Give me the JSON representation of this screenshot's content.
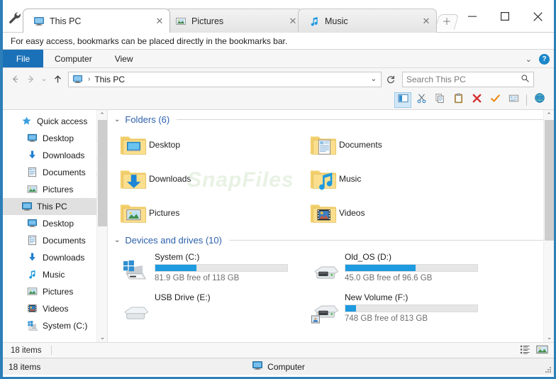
{
  "window": {
    "minimize_label": "─",
    "maximize_label": "☐",
    "close_label": "✕",
    "tools_icon": "wrench-icon"
  },
  "tabs": [
    {
      "label": "This PC",
      "icon": "this-pc-monitor-icon",
      "active": true,
      "close": "✕"
    },
    {
      "label": "Pictures",
      "icon": "pictures-image-icon",
      "active": false,
      "close": "✕"
    },
    {
      "label": "Music",
      "icon": "music-note-icon",
      "active": false,
      "close": "✕"
    }
  ],
  "new_tab": {
    "label": "＋"
  },
  "bookmark_hint": "For easy access, bookmarks can be placed directly in the bookmarks bar.",
  "ribbon": {
    "file_label": "File",
    "tabs": [
      "Computer",
      "View"
    ],
    "collapse_chevron": "⌄",
    "help_label": "?"
  },
  "address_bar": {
    "back": "←",
    "forward": "→",
    "recent": "⌄",
    "up": "↑",
    "icon": "this-pc-monitor-icon",
    "separator": "›",
    "path": "This PC",
    "dropdown": "⌄",
    "refresh": "↻"
  },
  "search": {
    "placeholder": "Search This PC",
    "value": "",
    "icon": "search-magnifier-icon"
  },
  "toolbar": {
    "items": [
      {
        "name": "preview-pane-button",
        "glyph": "preview-pane-icon",
        "selected": true
      },
      {
        "name": "cut-button",
        "glyph": "scissors-icon",
        "selected": false
      },
      {
        "name": "copy-button",
        "glyph": "copy-icon",
        "selected": false
      },
      {
        "name": "paste-button",
        "glyph": "clipboard-icon",
        "selected": false
      },
      {
        "name": "delete-button",
        "glyph": "red-x-icon",
        "selected": false
      },
      {
        "name": "confirm-button",
        "glyph": "orange-check-icon",
        "selected": false
      },
      {
        "name": "rename-button",
        "glyph": "rename-icon",
        "selected": false
      },
      {
        "name": "globe-button",
        "glyph": "globe-icon",
        "selected": false
      }
    ]
  },
  "sidebar": {
    "items": [
      {
        "label": "Quick access",
        "icon": "star-pin-icon",
        "indent": "lvl0",
        "pinned": false,
        "selected": false
      },
      {
        "label": "Desktop",
        "icon": "desktop-icon",
        "indent": "lvl1",
        "pinned": true,
        "selected": false
      },
      {
        "label": "Downloads",
        "icon": "downloads-icon",
        "indent": "lvl1",
        "pinned": true,
        "selected": false
      },
      {
        "label": "Documents",
        "icon": "documents-icon",
        "indent": "lvl1",
        "pinned": true,
        "selected": false
      },
      {
        "label": "Pictures",
        "icon": "pictures-icon",
        "indent": "lvl1",
        "pinned": true,
        "selected": false
      },
      {
        "label": "This PC",
        "icon": "this-pc-icon",
        "indent": "lvl0",
        "pinned": false,
        "selected": true
      },
      {
        "label": "Desktop",
        "icon": "desktop-icon",
        "indent": "lvl1",
        "pinned": false,
        "selected": false
      },
      {
        "label": "Documents",
        "icon": "documents-icon",
        "indent": "lvl1",
        "pinned": false,
        "selected": false
      },
      {
        "label": "Downloads",
        "icon": "downloads-icon",
        "indent": "lvl1",
        "pinned": false,
        "selected": false
      },
      {
        "label": "Music",
        "icon": "music-icon",
        "indent": "lvl1",
        "pinned": false,
        "selected": false
      },
      {
        "label": "Pictures",
        "icon": "pictures-icon",
        "indent": "lvl1",
        "pinned": false,
        "selected": false
      },
      {
        "label": "Videos",
        "icon": "videos-icon",
        "indent": "lvl1",
        "pinned": false,
        "selected": false
      },
      {
        "label": "System (C:)",
        "icon": "windows-drive-icon",
        "indent": "lvl1",
        "pinned": false,
        "selected": false
      }
    ],
    "scroll_up": "⌃",
    "scroll_down": "⌄"
  },
  "main": {
    "watermark": "SnapFiles",
    "groups": [
      {
        "title": "Folders (6)",
        "chevron": "⌄",
        "kind": "folders",
        "items": [
          {
            "label": "Desktop",
            "icon": "folder-desktop-icon"
          },
          {
            "label": "Documents",
            "icon": "folder-documents-icon"
          },
          {
            "label": "Downloads",
            "icon": "folder-downloads-icon"
          },
          {
            "label": "Music",
            "icon": "folder-music-icon"
          },
          {
            "label": "Pictures",
            "icon": "folder-pictures-icon"
          },
          {
            "label": "Videos",
            "icon": "folder-videos-icon"
          }
        ]
      },
      {
        "title": "Devices and drives (10)",
        "chevron": "⌄",
        "kind": "drives",
        "items": [
          {
            "label": "System (C:)",
            "icon": "windows-drive-icon",
            "free": "81.9 GB free of 118 GB",
            "used_percent": 31,
            "has_bar": true
          },
          {
            "label": "Old_OS (D:)",
            "icon": "hard-drive-icon",
            "free": "45.0 GB free of 96.6 GB",
            "used_percent": 53,
            "has_bar": true
          },
          {
            "label": "USB Drive (E:)",
            "icon": "usb-drive-icon",
            "free": "",
            "used_percent": 0,
            "has_bar": false
          },
          {
            "label": "New Volume (F:)",
            "icon": "shared-drive-icon",
            "free": "748 GB free of 813 GB",
            "used_percent": 8,
            "has_bar": true
          }
        ]
      }
    ],
    "scroll_up": "⌃",
    "scroll_down": "⌄"
  },
  "explorer_status": {
    "item_count": "18 items",
    "details_view_icon": "details-view-icon",
    "large_icons_view_icon": "large-icons-view-icon"
  },
  "app_status": {
    "item_count": "18 items",
    "location_label": "Computer",
    "location_icon": "this-pc-monitor-icon"
  },
  "colors": {
    "frame_blue": "#2c7fb8",
    "file_tab_blue": "#1b71b8",
    "group_header_blue": "#2b5faa",
    "progress_blue": "#1e9ae0",
    "selection_gray": "#e0e0e0",
    "delete_red": "#d32f2f",
    "check_orange": "#e8860c"
  }
}
